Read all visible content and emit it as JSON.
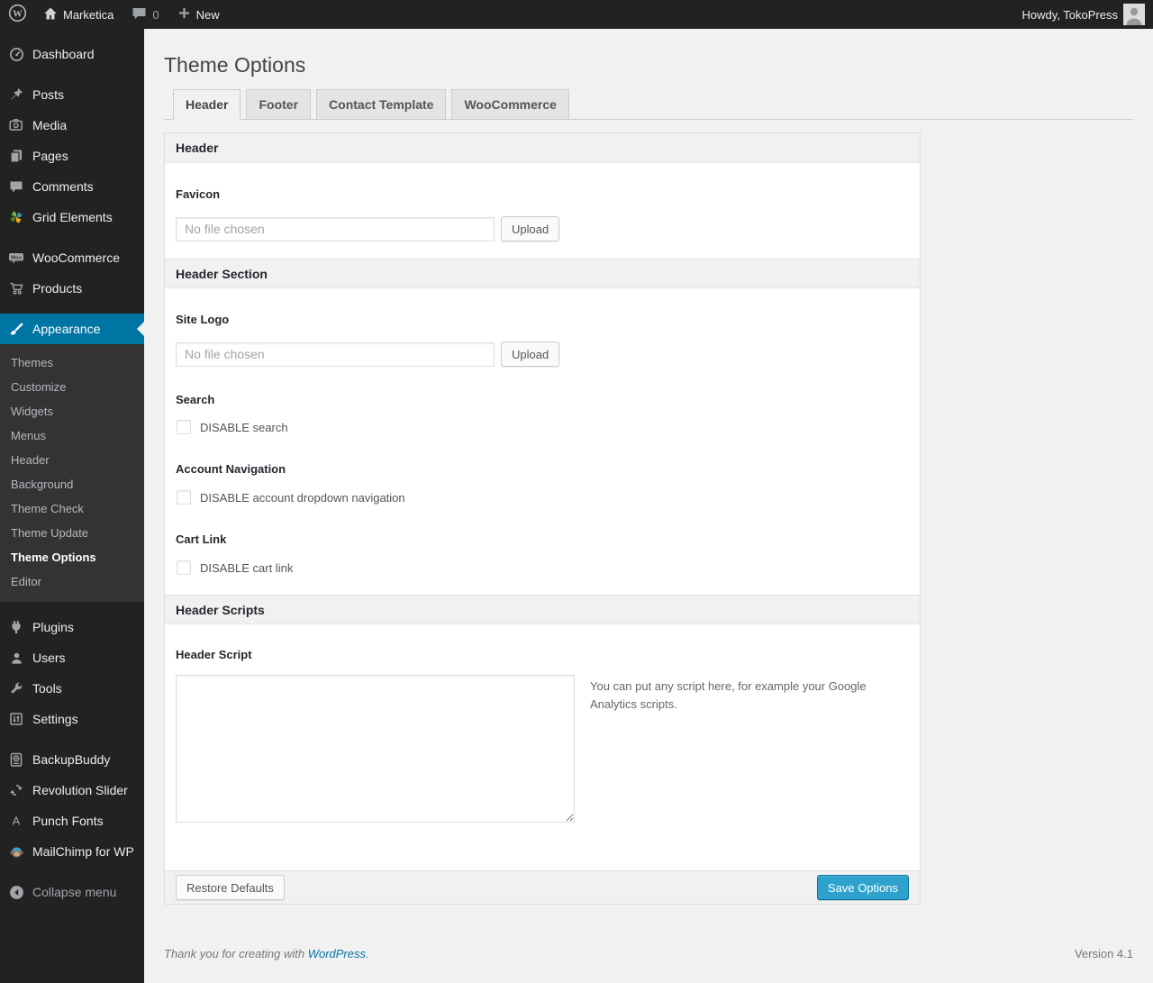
{
  "admin_bar": {
    "site_name": "Marketica",
    "comment_count": "0",
    "new_label": "New",
    "howdy": "Howdy, TokoPress"
  },
  "sidebar": {
    "items": [
      {
        "label": "Dashboard",
        "icon": "dashboard-icon"
      },
      {
        "label": "Posts",
        "icon": "pushpin-icon"
      },
      {
        "label": "Media",
        "icon": "media-icon"
      },
      {
        "label": "Pages",
        "icon": "pages-icon"
      },
      {
        "label": "Comments",
        "icon": "comments-icon"
      },
      {
        "label": "Grid Elements",
        "icon": "grid-elements-icon"
      },
      {
        "label": "WooCommerce",
        "icon": "woocommerce-icon"
      },
      {
        "label": "Products",
        "icon": "cart-icon"
      },
      {
        "label": "Appearance",
        "icon": "appearance-brush-icon",
        "active": true
      },
      {
        "label": "Plugins",
        "icon": "plugin-icon"
      },
      {
        "label": "Users",
        "icon": "user-icon"
      },
      {
        "label": "Tools",
        "icon": "wrench-icon"
      },
      {
        "label": "Settings",
        "icon": "settings-icon"
      },
      {
        "label": "BackupBuddy",
        "icon": "backupbuddy-icon"
      },
      {
        "label": "Revolution Slider",
        "icon": "revolution-slider-icon"
      },
      {
        "label": "Punch Fonts",
        "icon": "punch-fonts-icon"
      },
      {
        "label": "MailChimp for WP",
        "icon": "mailchimp-icon"
      },
      {
        "label": "Collapse menu",
        "icon": "collapse-icon"
      }
    ],
    "appearance_submenu": [
      "Themes",
      "Customize",
      "Widgets",
      "Menus",
      "Header",
      "Background",
      "Theme Check",
      "Theme Update",
      "Theme Options",
      "Editor"
    ],
    "current_submenu_item": "Theme Options"
  },
  "page": {
    "title": "Theme Options",
    "tabs": [
      {
        "label": "Header",
        "active": true
      },
      {
        "label": "Footer",
        "active": false
      },
      {
        "label": "Contact Template",
        "active": false
      },
      {
        "label": "WooCommerce",
        "active": false
      }
    ]
  },
  "panel": {
    "sections": [
      {
        "title": "Header"
      },
      {
        "title": "Header Section"
      },
      {
        "title": "Header Scripts"
      }
    ],
    "favicon": {
      "label": "Favicon",
      "file_value": "No file chosen",
      "upload_label": "Upload"
    },
    "site_logo": {
      "label": "Site Logo",
      "file_value": "No file chosen",
      "upload_label": "Upload"
    },
    "search": {
      "label": "Search",
      "checkbox_label": "DISABLE search",
      "checked": false
    },
    "account_nav": {
      "label": "Account Navigation",
      "checkbox_label": "DISABLE account dropdown navigation",
      "checked": false
    },
    "cart_link": {
      "label": "Cart Link",
      "checkbox_label": "DISABLE cart link",
      "checked": false
    },
    "header_script": {
      "label": "Header Script",
      "value": "",
      "helper": "You can put any script here, for example your Google Analytics scripts."
    },
    "footer": {
      "restore_label": "Restore Defaults",
      "save_label": "Save Options"
    }
  },
  "page_footer": {
    "thanks_prefix": "Thank you for creating with",
    "wordpress_link": "WordPress",
    "suffix": ".",
    "version": "Version 4.1"
  },
  "colors": {
    "admin_bar_bg": "#222222",
    "sidebar_bg": "#222222",
    "submenu_bg": "#333333",
    "menu_highlight": "#0074a2",
    "primary_button": "#2ea2cc",
    "primary_button_border": "#0074a2",
    "content_bg": "#f1f1f1",
    "link": "#0074a2"
  }
}
